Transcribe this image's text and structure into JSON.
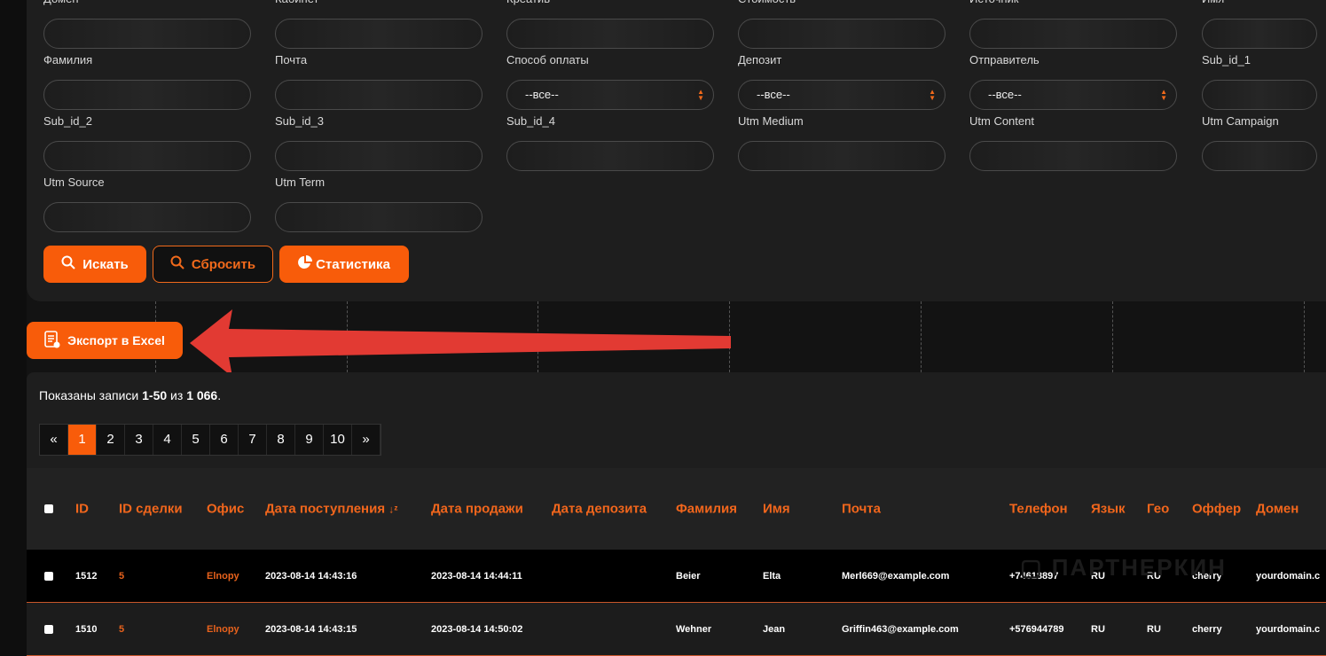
{
  "filters": {
    "rows": [
      [
        {
          "label": "Домен"
        },
        {
          "label": "Кабинет"
        },
        {
          "label": "Креатив"
        },
        {
          "label": "Стоимость"
        },
        {
          "label": "Источник"
        },
        {
          "label": "Имя"
        }
      ],
      [
        {
          "label": "Фамилия"
        },
        {
          "label": "Почта"
        },
        {
          "label": "Способ оплаты",
          "value": "--все--"
        },
        {
          "label": "Депозит",
          "value": "--все--"
        },
        {
          "label": "Отправитель",
          "value": "--все--"
        },
        {
          "label": "Sub_id_1"
        }
      ],
      [
        {
          "label": "Sub_id_2"
        },
        {
          "label": "Sub_id_3"
        },
        {
          "label": "Sub_id_4"
        },
        {
          "label": "Utm Medium"
        },
        {
          "label": "Utm Content"
        },
        {
          "label": "Utm Campaign"
        }
      ],
      [
        {
          "label": "Utm Source"
        },
        {
          "label": "Utm Term"
        }
      ]
    ],
    "search_label": "Искать",
    "reset_label": "Сбросить",
    "stats_label": "Статистика"
  },
  "export_label": "Экспорт в Excel",
  "summary": {
    "prefix": "Показаны записи ",
    "range": "1-50",
    "middle": " из ",
    "total": "1 066",
    "suffix": "."
  },
  "pagination": {
    "prev": "«",
    "pages": [
      "1",
      "2",
      "3",
      "4",
      "5",
      "6",
      "7",
      "8",
      "9",
      "10"
    ],
    "next": "»",
    "active": "1"
  },
  "table": {
    "headers": [
      "ID",
      "ID сделки",
      "Офис",
      "Дата поступления",
      "Дата продажи",
      "Дата депозита",
      "Фамилия",
      "Имя",
      "Почта",
      "Телефон",
      "Язык",
      "Гео",
      "Оффер",
      "Домен"
    ],
    "rows": [
      [
        "1512",
        "5",
        "Elnopy",
        "2023-08-14 14:43:16",
        "2023-08-14 14:44:11",
        "",
        "Beier",
        "Elta",
        "Merl669@example.com",
        "+74618897",
        "RU",
        "RU",
        "cherry",
        "yourdomain.c"
      ],
      [
        "1510",
        "5",
        "Elnopy",
        "2023-08-14 14:43:15",
        "2023-08-14 14:50:02",
        "",
        "Wehner",
        "Jean",
        "Griffin463@example.com",
        "+576944789",
        "RU",
        "RU",
        "cherry",
        "yourdomain.c"
      ]
    ]
  },
  "watermark": "ПАРТНЕРКИН",
  "colors": {
    "accent": "#f85c0a",
    "arrow": "#e23a33"
  }
}
